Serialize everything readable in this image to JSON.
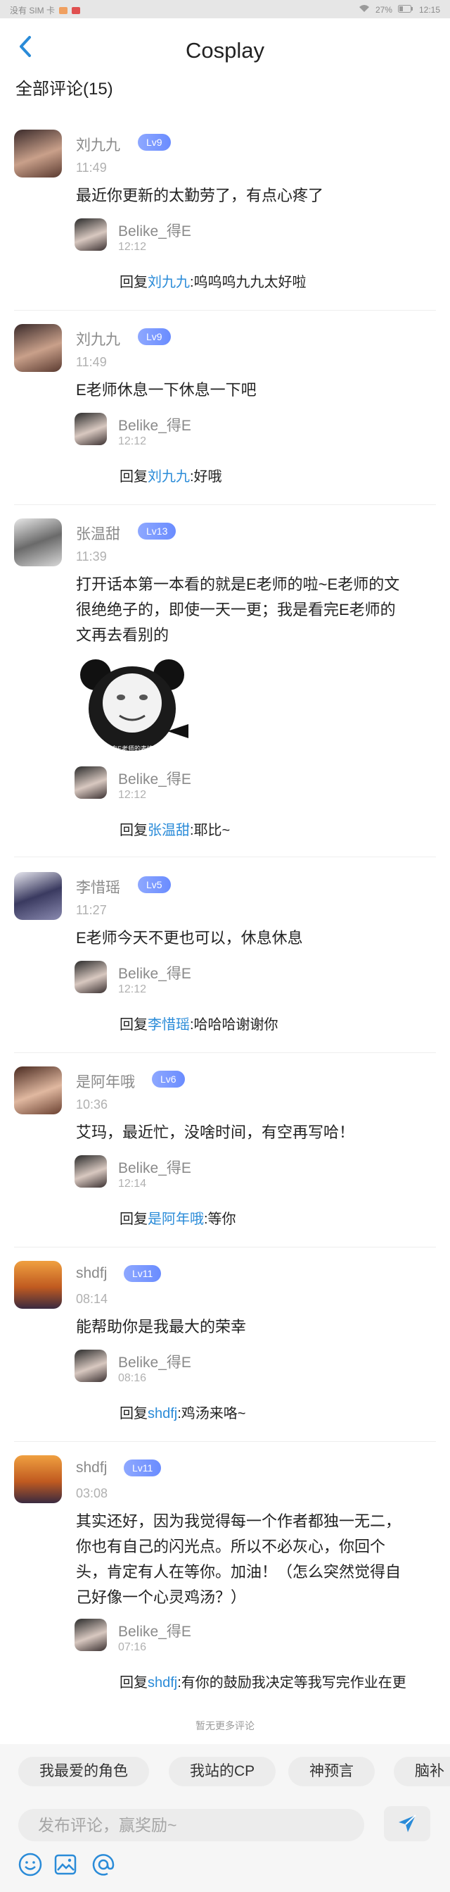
{
  "status_bar": {
    "left_text": "没有 SIM 卡",
    "battery": "27%",
    "time": "12:15"
  },
  "header": {
    "title": "Cosplay",
    "back_icon": "chevron-left-icon"
  },
  "section_title": "全部评论(15)",
  "comments": [
    {
      "name": "刘九九",
      "level": "Lv9",
      "time": "11:49",
      "text": "最近你更新的太勤劳了，有点心疼了",
      "reply": {
        "name": "Belike_得E",
        "time": "12:12",
        "prefix": "回复",
        "to": "刘九九",
        "text": ":呜呜呜九九太好啦"
      }
    },
    {
      "name": "刘九九",
      "level": "Lv9",
      "time": "11:49",
      "text": "E老师休息一下休息一下吧",
      "reply": {
        "name": "Belike_得E",
        "time": "12:12",
        "prefix": "回复",
        "to": "刘九九",
        "text": ":好哦"
      }
    },
    {
      "name": "张温甜",
      "level": "Lv13",
      "time": "11:39",
      "text_lines": [
        "打开话本第一本看的就是E老师的啦~E老师的文",
        "很绝绝子的，即使一天一更；我是看完E老师的",
        "文再去看别的"
      ],
      "sticker_caption": "来自E老师的表情包",
      "reply": {
        "name": "Belike_得E",
        "time": "12:12",
        "prefix": "回复",
        "to": "张温甜",
        "text": ":耶比~"
      }
    },
    {
      "name": "李惜瑶",
      "level": "Lv5",
      "time": "11:27",
      "text": "E老师今天不更也可以，休息休息",
      "reply": {
        "name": "Belike_得E",
        "time": "12:12",
        "prefix": "回复",
        "to": "李惜瑶",
        "text": ":哈哈哈谢谢你"
      }
    },
    {
      "name": "是阿年哦",
      "level": "Lv6",
      "time": "10:36",
      "text": "艾玛，最近忙，没啥时间，有空再写哈！",
      "reply": {
        "name": "Belike_得E",
        "time": "12:14",
        "prefix": "回复",
        "to": "是阿年哦",
        "text": ":等你"
      }
    },
    {
      "name": "shdfj",
      "level": "Lv11",
      "time": "08:14",
      "text": "能帮助你是我最大的荣幸",
      "reply": {
        "name": "Belike_得E",
        "time": "08:16",
        "prefix": "回复",
        "to": "shdfj",
        "text": ":鸡汤来咯~"
      }
    },
    {
      "name": "shdfj",
      "level": "Lv11",
      "time": "03:08",
      "text_lines": [
        "其实还好，因为我觉得每一个作者都独一无二，",
        "你也有自己的闪光点。所以不必灰心，你回个",
        "头，肯定有人在等你。加油！（怎么突然觉得自",
        "己好像一个心灵鸡汤？）"
      ],
      "reply": {
        "name": "Belike_得E",
        "time": "07:16",
        "prefix": "回复",
        "to": "shdfj",
        "text": ":有你的鼓励我决定等我写完作业在更"
      }
    }
  ],
  "no_more": "暂无更多评论",
  "tags": [
    "我最爱的角色",
    "我站的CP",
    "神预言",
    "脑补"
  ],
  "composer": {
    "placeholder": "发布评论，赢奖励~",
    "send_icon": "send-icon",
    "tools": [
      "emoji-icon",
      "image-icon",
      "mention-icon"
    ]
  },
  "colors": {
    "link": "#2a8bd8",
    "level_badge": "#7a96ff",
    "send": "#2a8bd8"
  }
}
